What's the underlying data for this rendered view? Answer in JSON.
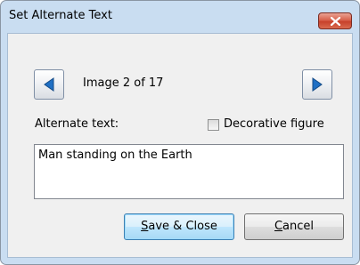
{
  "dialog": {
    "title": "Set Alternate Text",
    "close_icon": "close-x-icon"
  },
  "navigation": {
    "prev_icon": "left-triangle-icon",
    "next_icon": "right-triangle-icon",
    "counter_text": "Image 2 of 17"
  },
  "form": {
    "alt_label": "Alternate text:",
    "decorative_label": "Decorative figure",
    "decorative_checked": false,
    "alt_value": "Man standing on the Earth"
  },
  "buttons": {
    "save_accel": "S",
    "save_rest": "ave & Close",
    "cancel_accel": "C",
    "cancel_rest": "ancel"
  },
  "colors": {
    "window_frame": "#c9ddf1",
    "close_button": "#c7412b",
    "nav_arrow": "#1f6fc4",
    "default_button": "#3c7fb1"
  }
}
